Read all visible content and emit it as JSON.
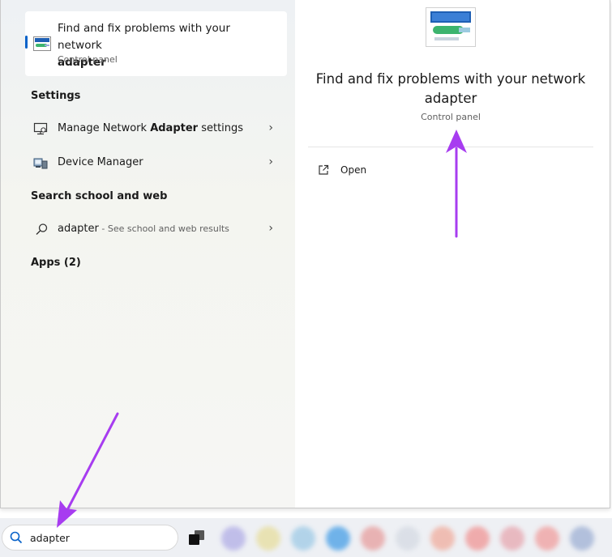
{
  "top_result": {
    "title_prefix": "Find and fix problems with your network",
    "title_bold": "adapter",
    "subtitle": "Control panel"
  },
  "settings": {
    "heading": "Settings",
    "items": [
      {
        "pre": "Manage Network ",
        "bold": "Adapter",
        "post": " settings"
      },
      {
        "pre": "Device Manager",
        "bold": "",
        "post": ""
      }
    ]
  },
  "web": {
    "heading": "Search school and web",
    "query": "adapter",
    "hint": " - See school and web results"
  },
  "apps": {
    "heading": "Apps (2)"
  },
  "preview": {
    "title": "Find and fix problems with your network adapter",
    "subtitle": "Control panel",
    "open_label": "Open"
  },
  "taskbar": {
    "search_value": "adapter",
    "blurred_app_colors": [
      "#b9b6e8",
      "#e8e0a8",
      "#a8cfe8",
      "#5aa8e8",
      "#e8a8a8",
      "#d8dde5",
      "#f0b5a8",
      "#f0a0a0",
      "#e8b0b8",
      "#f0a8a8",
      "#a8b8d8"
    ]
  },
  "accent_color": "#0a63c9",
  "annotation_color": "#a73cf0"
}
